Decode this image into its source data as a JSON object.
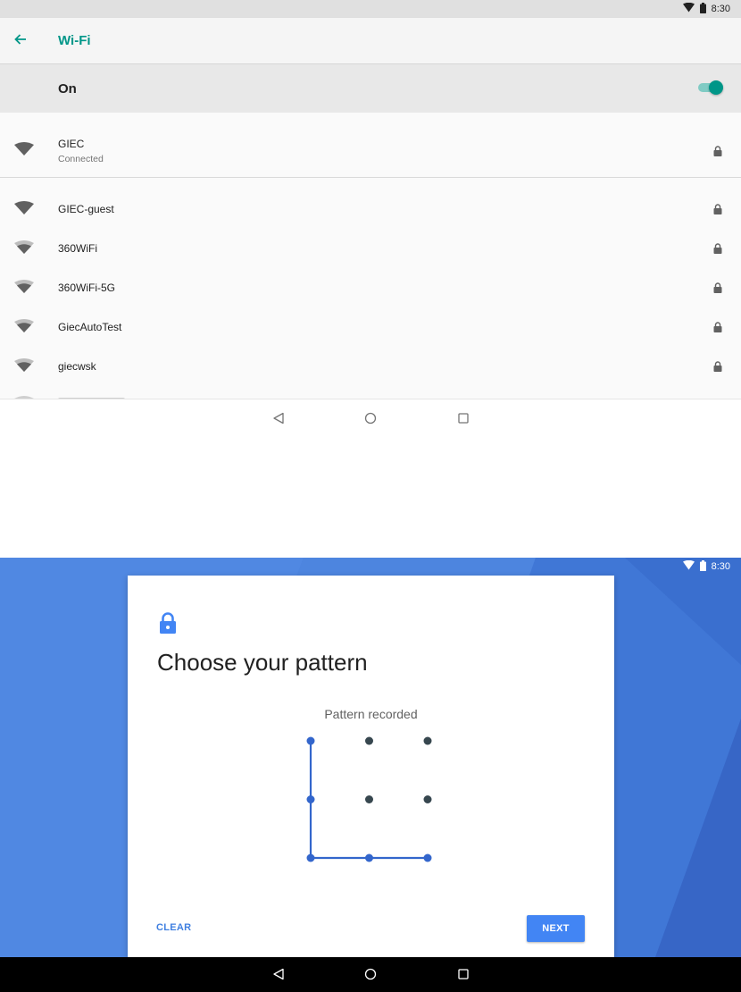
{
  "wifi_screen": {
    "status_bar": {
      "time": "8:30",
      "icons": [
        "wifi-signal-icon",
        "battery-icon"
      ]
    },
    "app_bar": {
      "back_icon": "arrow-back-icon",
      "title": "Wi-Fi"
    },
    "master_switch": {
      "label": "On",
      "state": "on"
    },
    "connected_network": {
      "name": "GIEC",
      "status": "Connected",
      "secured": true,
      "signal_bars": 4
    },
    "networks": [
      {
        "name": "GIEC-guest",
        "secured": true,
        "signal_bars": 4
      },
      {
        "name": "360WiFi",
        "secured": true,
        "signal_bars": 3
      },
      {
        "name": "360WiFi-5G",
        "secured": true,
        "signal_bars": 3
      },
      {
        "name": "GiecAutoTest",
        "secured": true,
        "signal_bars": 3
      },
      {
        "name": "giecwsk",
        "secured": true,
        "signal_bars": 3
      }
    ],
    "nav_bar": [
      "back-icon",
      "home-icon",
      "recents-icon"
    ]
  },
  "pattern_screen": {
    "status_bar": {
      "time": "8:30",
      "icons": [
        "wifi-signal-icon",
        "battery-icon"
      ]
    },
    "lock_icon": "lock-icon",
    "title": "Choose your pattern",
    "status_message": "Pattern recorded",
    "pattern": {
      "grid": 3,
      "path": [
        [
          0,
          0
        ],
        [
          1,
          0
        ],
        [
          2,
          0
        ],
        [
          2,
          1
        ],
        [
          2,
          2
        ]
      ]
    },
    "buttons": {
      "clear": "CLEAR",
      "next": "NEXT"
    },
    "nav_bar": [
      "back-icon",
      "home-icon",
      "recents-icon"
    ]
  },
  "colors": {
    "accent_teal": "#009688",
    "accent_blue": "#4285f4",
    "pattern_line": "#3366cc",
    "dot_inactive": "#37474f",
    "background_blue": "#4a7fdc"
  }
}
